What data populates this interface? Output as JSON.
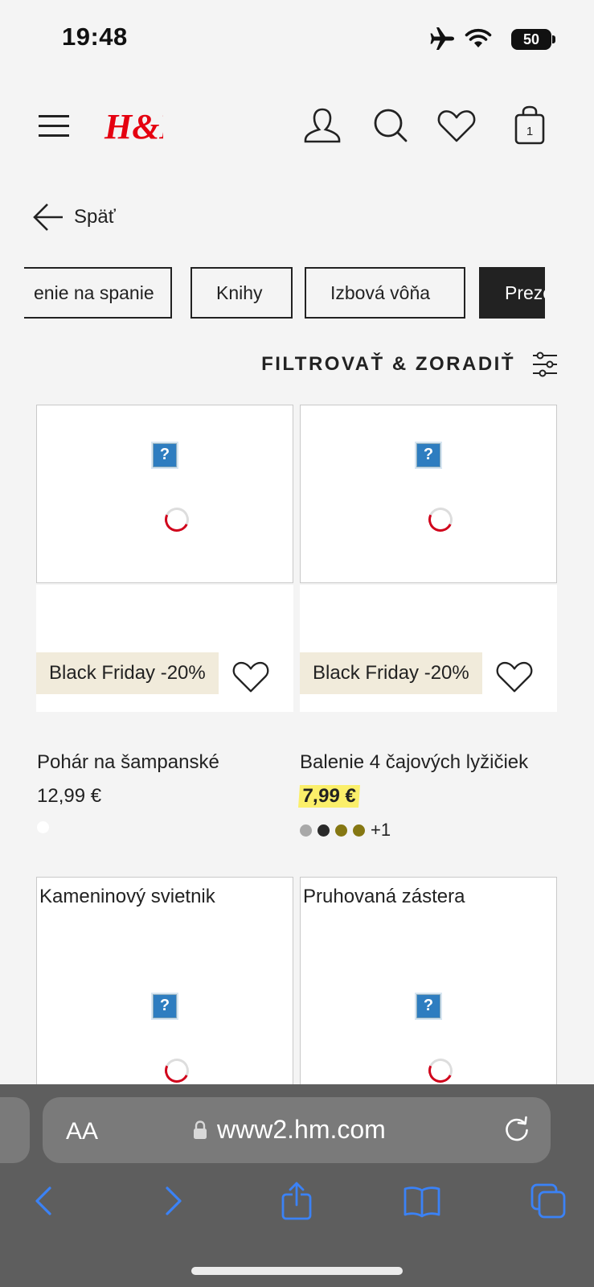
{
  "status": {
    "time": "19:48",
    "battery": "50"
  },
  "header": {
    "brand": "H&M",
    "cart_count": "1"
  },
  "back": {
    "label": "Späť"
  },
  "chips": [
    "enie na spanie",
    "Knihy",
    "Izbová vôňa",
    "Prezents"
  ],
  "filter": {
    "label": "FILTROVAŤ & ZORADIŤ"
  },
  "products": [
    {
      "name": "Pohár na šampanské",
      "price": "12,99 €",
      "badge": "Black Friday -20%",
      "swatches": [
        "#ffffff"
      ],
      "more": ""
    },
    {
      "name": "Balenie 4 čajových lyžičiek",
      "price": "7,99 €",
      "badge": "Black Friday -20%",
      "swatches": [
        "#a8a8a8",
        "#2a2a2a",
        "#857712",
        "#857712"
      ],
      "more": "+1"
    }
  ],
  "products_row2": [
    {
      "name": "Kameninový svietnik"
    },
    {
      "name": "Pruhovaná zástera"
    }
  ],
  "broken_image_glyph": "?",
  "safari": {
    "text_size": "AA",
    "url": "www2.hm.com"
  },
  "colors": {
    "sale_highlight": "#fbef6a",
    "badge_bg": "#f1ebdb",
    "safari_blue": "#3b82f6",
    "brand_red": "#e50010"
  }
}
